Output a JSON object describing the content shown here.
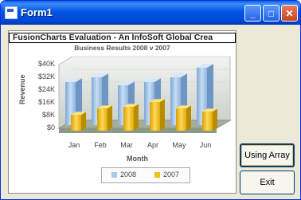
{
  "window": {
    "title": "Form1"
  },
  "titlebar_buttons": {
    "minimize": "_",
    "maximize": "□",
    "close": "✕"
  },
  "buttons": {
    "using_array": "Using Array",
    "exit": "Exit"
  },
  "colors": {
    "series_2008": "#a8c8ec",
    "series_2007": "#f2c01e"
  },
  "chart_data": {
    "type": "bar",
    "title": "FusionCharts Evaluation - An InfoSoft Global Crea",
    "subtitle": "Business Results 2008 v 2007",
    "xlabel": "Month",
    "ylabel": "Revenue",
    "yticks": [
      "$0",
      "$8K",
      "$16K",
      "$24K",
      "$32K",
      "$40K"
    ],
    "ylim": [
      0,
      40000
    ],
    "categories": [
      "Jan",
      "Feb",
      "Mar",
      "Apr",
      "May",
      "Jun"
    ],
    "series": [
      {
        "name": "2008",
        "values": [
          27000,
          30000,
          25000,
          27000,
          30000,
          36000
        ]
      },
      {
        "name": "2007",
        "values": [
          10000,
          14000,
          15000,
          18000,
          14000,
          12000
        ]
      }
    ],
    "legend": [
      "2008",
      "2007"
    ]
  }
}
